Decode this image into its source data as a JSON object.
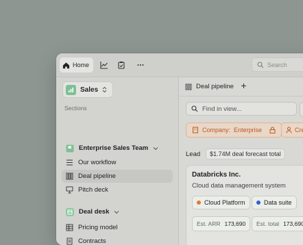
{
  "topbar": {
    "home_label": "Home",
    "search_placeholder": "Search"
  },
  "sidebar": {
    "workspace": "Sales",
    "section_label": "Sections",
    "groups": [
      {
        "label": "Enterprise Sales Team",
        "items": [
          "Our workflow",
          "Deal pipeline",
          "Pitch deck"
        ]
      },
      {
        "label": "Deal desk",
        "items": [
          "Pricing model",
          "Contracts"
        ]
      }
    ]
  },
  "main": {
    "tab_label": "Deal pipeline",
    "find_placeholder": "Find in view...",
    "filter_label": "Company:",
    "filter_value": "Enterprise",
    "filter2_label": "Cre",
    "lead_label": "Lead",
    "forecast": "$1.74M deal forecast total",
    "card": {
      "title": "Databricks Inc.",
      "subtitle": "Cloud data management system",
      "tags": [
        {
          "label": "Cloud Platform",
          "color": "#e07a2e"
        },
        {
          "label": "Data suite",
          "color": "#2f5fd0"
        }
      ],
      "stats": [
        {
          "key": "Est. ARR",
          "value": "173,690"
        },
        {
          "key": "Est. total",
          "value": "173,690"
        }
      ]
    }
  }
}
